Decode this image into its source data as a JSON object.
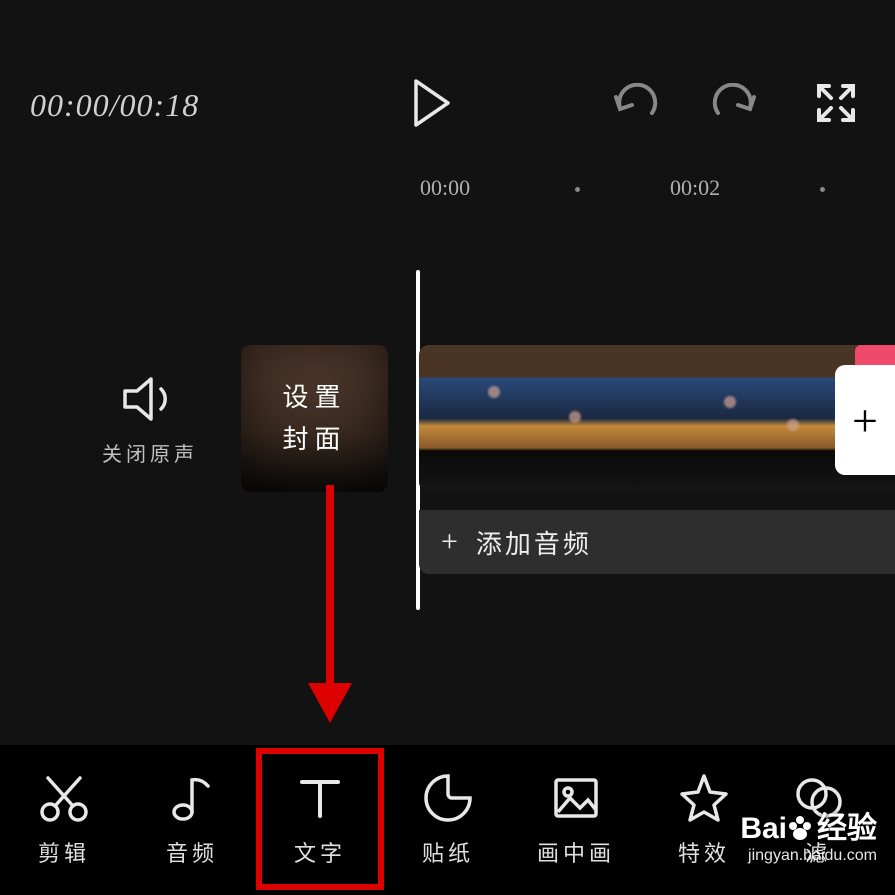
{
  "time_display": "00:00/00:18",
  "ruler": {
    "t1": "00:00",
    "t2": "00:02"
  },
  "mute_label": "关闭原声",
  "cover_label_line1": "设置",
  "cover_label_line2": "封面",
  "add_clip_symbol": "+",
  "audio": {
    "plus": "+",
    "label": "添加音频"
  },
  "toolbar": [
    {
      "key": "cut",
      "label": "剪辑"
    },
    {
      "key": "audio",
      "label": "音频"
    },
    {
      "key": "text",
      "label": "文字"
    },
    {
      "key": "sticker",
      "label": "贴纸"
    },
    {
      "key": "pip",
      "label": "画中画"
    },
    {
      "key": "effect",
      "label": "特效"
    },
    {
      "key": "filter",
      "label": "滤"
    }
  ],
  "watermark": {
    "brand": "Bai",
    "brand2": "经验",
    "url": "jingyan.baidu.com"
  }
}
